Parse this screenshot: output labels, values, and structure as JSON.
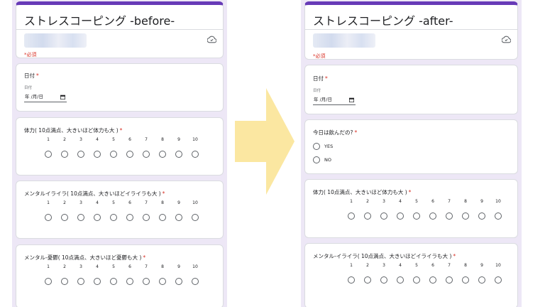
{
  "before": {
    "title": "ストレスコーピング -before-",
    "required_note": "*必須",
    "date_question": {
      "label": "日付",
      "sub_label": "日付",
      "value": "年 /月/日"
    },
    "scale_questions": [
      {
        "label": "体力( 10点満点、大きいほど体力も大 )"
      },
      {
        "label": "メンタルイライラ( 10点満点、大きいほどイライラも大 )"
      },
      {
        "label": "メンタル-憂鬱( 10点満点、大きいほど憂鬱も大 )"
      }
    ]
  },
  "after": {
    "title": "ストレスコーピング -after-",
    "required_note": "*必須",
    "date_question": {
      "label": "日付",
      "sub_label": "日付",
      "value": "年 /月/日"
    },
    "choice_question": {
      "label": "今日は飲んだの?",
      "options": [
        "YES",
        "NO"
      ]
    },
    "scale_questions": [
      {
        "label": "体力( 10点満点、大きいほど体力も大 )"
      },
      {
        "label": "メンタル-イライラ( 10点満点、大きいほどイライラも大 )"
      }
    ]
  },
  "scale_numbers": [
    "1",
    "2",
    "3",
    "4",
    "5",
    "6",
    "7",
    "8",
    "9",
    "10"
  ],
  "required_mark": "*",
  "icons": {
    "cloud": "cloud-done-icon",
    "calendar": "calendar-icon",
    "arrow": "right-arrow-icon"
  },
  "colors": {
    "form_bg": "#ede7f6",
    "accent": "#673ab7",
    "required": "#d93025",
    "arrow": "#fbe7a1"
  }
}
